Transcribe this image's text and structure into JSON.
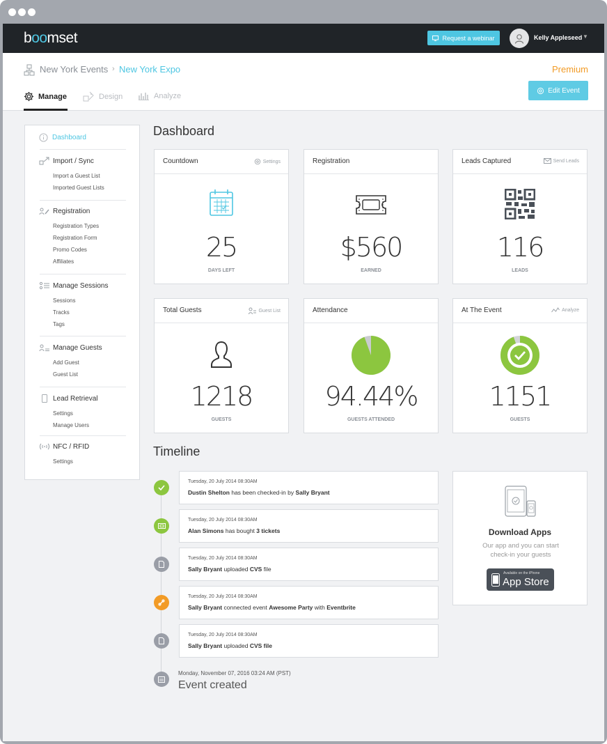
{
  "topbar": {
    "logo": "boomset",
    "webinar_label": "Request a webinar",
    "user_name": "Kelly Appleseed"
  },
  "header": {
    "breadcrumb_parent": "New York Events",
    "breadcrumb_separator": "›",
    "breadcrumb_current": "New York Expo",
    "plan": "Premium",
    "edit_button": "Edit Event",
    "tabs": [
      {
        "label": "Manage",
        "active": true
      },
      {
        "label": "Design",
        "active": false
      },
      {
        "label": "Analyze",
        "active": false
      }
    ]
  },
  "sidebar": {
    "dashboard": "Dashboard",
    "sections": [
      {
        "title": "Import / Sync",
        "icon": "import-icon",
        "items": [
          "Import a Guest List",
          "Imported Guest Lists"
        ]
      },
      {
        "title": "Registration",
        "icon": "registration-icon",
        "items": [
          "Registration Types",
          "Registration Form",
          "Promo Codes",
          "Affiliates"
        ]
      },
      {
        "title": "Manage Sessions",
        "icon": "sessions-icon",
        "items": [
          "Sessions",
          "Tracks",
          "Tags"
        ]
      },
      {
        "title": "Manage Guests",
        "icon": "guests-icon",
        "items": [
          "Add Guest",
          "Guest List"
        ]
      },
      {
        "title": "Lead Retrieval",
        "icon": "phone-icon",
        "items": [
          "Settings",
          "Manage Users"
        ]
      },
      {
        "title": "NFC / RFID",
        "icon": "nfc-icon",
        "items": [
          "Settings"
        ]
      }
    ]
  },
  "dashboard": {
    "title": "Dashboard",
    "cards": [
      {
        "title": "Countdown",
        "link": "Settings",
        "value": "25",
        "label": "DAYS LEFT",
        "icon": "calendar-icon"
      },
      {
        "title": "Registration",
        "link": "",
        "value": "$560",
        "label": "EARNED",
        "icon": "ticket-icon"
      },
      {
        "title": "Leads Captured",
        "link": "Send Leads",
        "value": "116",
        "label": "LEADS",
        "icon": "qr-code-icon"
      },
      {
        "title": "Total Guests",
        "link": "Guest List",
        "value": "1218",
        "label": "GUESTS",
        "icon": "person-icon"
      },
      {
        "title": "Attendance",
        "link": "",
        "value": "94.44%",
        "label": "GUESTS ATTENDED",
        "icon": "pie-chart-icon",
        "fraction": 0.9444
      },
      {
        "title": "At The Event",
        "link": "Analyze",
        "value": "1151",
        "label": "GUESTS",
        "icon": "donut-check-icon",
        "fraction": 0.945
      }
    ]
  },
  "timeline": {
    "title": "Timeline",
    "items": [
      {
        "time": "Tuesday, 20 July 2014 08:30AM",
        "parts": [
          [
            "b",
            "Dustin Shelton"
          ],
          [
            "t",
            " has been checked-in by "
          ],
          [
            "b",
            "Sally Bryant"
          ]
        ],
        "color": "#8cc63f",
        "icon": "check-icon"
      },
      {
        "time": "Tuesday, 20 July 2014 08:30AM",
        "parts": [
          [
            "b",
            "Alan Simons"
          ],
          [
            "t",
            " has bought "
          ],
          [
            "b",
            "3 tickets"
          ]
        ],
        "color": "#8cc63f",
        "icon": "ticket-icon"
      },
      {
        "time": "Tuesday, 20 July 2014 08:30AM",
        "parts": [
          [
            "b",
            "Sally Bryant"
          ],
          [
            "t",
            " uploaded "
          ],
          [
            "b",
            "CVS"
          ],
          [
            "t",
            " file"
          ]
        ],
        "color": "#9a9ea7",
        "icon": "file-icon"
      },
      {
        "time": "Tuesday, 20 July 2014 08:30AM",
        "parts": [
          [
            "b",
            "Sally Bryant"
          ],
          [
            "t",
            " connected event "
          ],
          [
            "b",
            "Awesome Party"
          ],
          [
            "t",
            " with "
          ],
          [
            "b",
            "Eventbrite"
          ]
        ],
        "color": "#f29b26",
        "icon": "link-icon"
      },
      {
        "time": "Tuesday, 20 July 2014 08:30AM",
        "parts": [
          [
            "b",
            "Sally Bryant"
          ],
          [
            "t",
            " uploaded "
          ],
          [
            "b",
            "CVS file"
          ]
        ],
        "color": "#9a9ea7",
        "icon": "file-icon"
      }
    ],
    "created_time": "Monday, November 07, 2016 03:24 AM (PST)",
    "created_text": "Event created"
  },
  "apps": {
    "title": "Download Apps",
    "description": "Our app and you can start check-in your guests",
    "store_small": "Available on the iPhone",
    "store_big": "App Store"
  },
  "colors": {
    "accent": "#4ec6e2",
    "premium": "#f29b26",
    "green": "#8cc63f",
    "grey": "#9a9ea7",
    "topbar": "#202428"
  }
}
